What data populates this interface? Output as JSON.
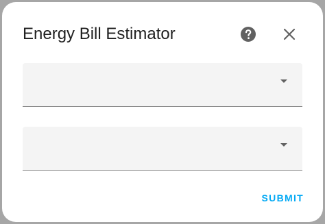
{
  "dialog": {
    "title": "Energy Bill Estimator",
    "help_icon": "help-circle-icon",
    "close_icon": "close-icon"
  },
  "fields": [
    {
      "value": "",
      "icon": "dropdown-arrow-icon"
    },
    {
      "value": "",
      "icon": "dropdown-arrow-icon"
    }
  ],
  "actions": {
    "submit_label": "SUBMIT"
  },
  "colors": {
    "accent": "#03a9f4",
    "field_background": "#f4f4f4",
    "backdrop": "#a6a6a6",
    "icon": "#616161"
  }
}
